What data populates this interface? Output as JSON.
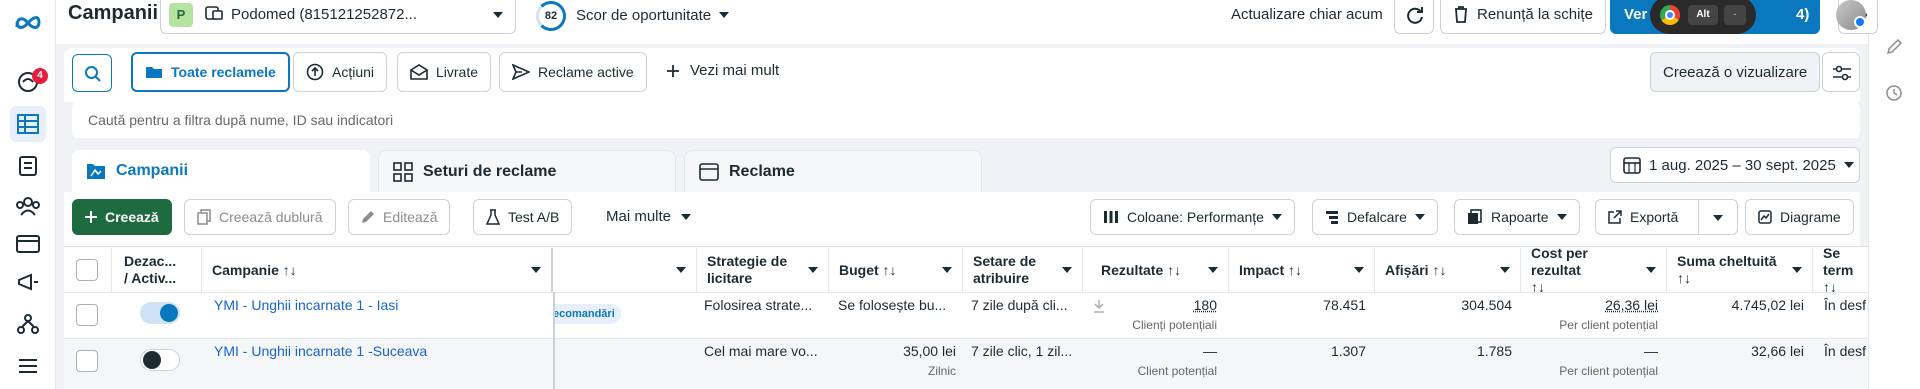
{
  "header": {
    "title": "Campanii",
    "account_badge": "P",
    "account_name": "Podomed (815121252872...",
    "opportunity_score": "82",
    "opportunity_label": "Scor de oportunitate",
    "refresh_label": "Actualizare chiar acum",
    "discard_label": "Renunță la schițe",
    "publish_label": "Ver",
    "publish_suffix": "4)",
    "overlay_key": "Alt",
    "overlay_dot": "."
  },
  "toolbar": {
    "filters": [
      "Toate reclamele",
      "Acțiuni",
      "Livrate",
      "Reclame active"
    ],
    "more_label": "Vezi mai mult",
    "create_view_label": "Creează o vizualizare",
    "search_placeholder": "Caută pentru a filtra după nume, ID sau indicatori"
  },
  "tabs": [
    {
      "label": "Campanii",
      "active": true
    },
    {
      "label": "Seturi de reclame",
      "active": false
    },
    {
      "label": "Reclame",
      "active": false
    }
  ],
  "date_range": "1 aug. 2025 – 30 sept. 2025",
  "actions": {
    "create": "Creează",
    "duplicate": "Creează dublură",
    "edit": "Editează",
    "ab_test": "Test A/B",
    "more": "Mai multe",
    "columns": "Coloane: Performanțe",
    "breakdown": "Defalcare",
    "reports": "Rapoarte",
    "export": "Exportă",
    "charts": "Diagrame"
  },
  "leftnav": {
    "notifications_count": "4"
  },
  "table": {
    "headers": {
      "toggle": [
        "Dezac...",
        "/ Activ..."
      ],
      "campaign": "Campanie ↑↓",
      "strategy": [
        "Strategie de",
        "licitare"
      ],
      "budget": "Buget ↑↓",
      "attribution": [
        "Setare de",
        "atribuire"
      ],
      "results": "Rezultate ↑↓",
      "impact": "Impact ↑↓",
      "impressions": "Afișări ↑↓",
      "cost_per_result": [
        "Cost per rezultat",
        "↑↓"
      ],
      "amount_spent": [
        "Suma cheltuită",
        "↑↓"
      ],
      "end": [
        "Se term",
        "↑↓"
      ]
    },
    "rows": [
      {
        "campaign": "YMI - Unghii incarnate 1 - Iasi",
        "status_on": true,
        "tag": "ecomandări",
        "strategy": "Folosirea strate...",
        "budget": "Se folosește bu...",
        "budget_sub": "",
        "attribution": "7 zile după cli...",
        "results": "180",
        "results_sub": "Clienți potențiali",
        "impact": "78.451",
        "impressions": "304.504",
        "cost_per_result": "26,36 lei",
        "cost_sub": "Per client potențial",
        "amount_spent": "4.745,02 lei",
        "end": "În desf"
      },
      {
        "campaign": "YMI - Unghii incarnate 1 -Suceava",
        "status_on": false,
        "tag": "",
        "strategy": "Cel mai mare vo...",
        "budget": "35,00 lei",
        "budget_sub": "Zilnic",
        "attribution": "7 zile clic, 1 zil...",
        "results": "—",
        "results_sub": "Client potențial",
        "impact": "1.307",
        "impressions": "1.785",
        "cost_per_result": "—",
        "cost_sub": "Per client potențial",
        "amount_spent": "32,66 lei",
        "end": "În desf"
      }
    ]
  },
  "colors": {
    "primary": "#0a78be",
    "create_green": "#1d6b3e",
    "link": "#1763cf",
    "badge_red": "#e41e3f"
  }
}
